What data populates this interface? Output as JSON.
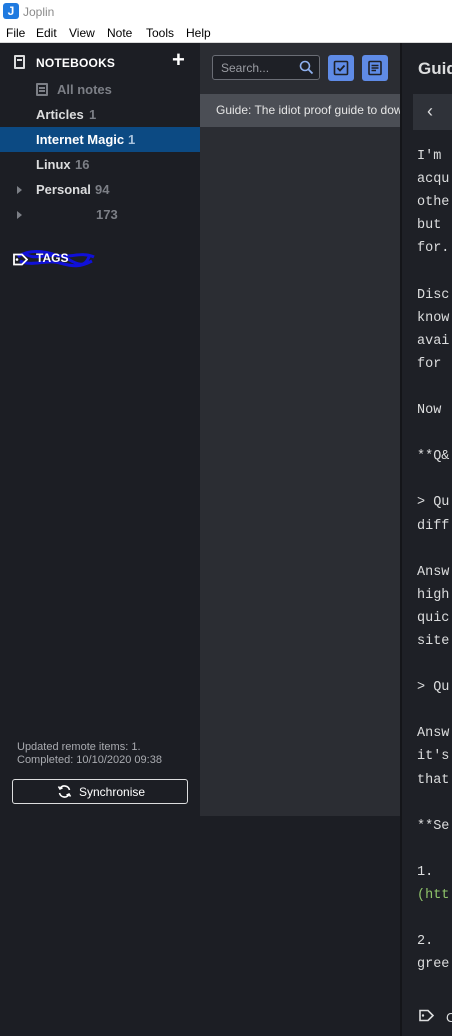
{
  "window": {
    "title": "Joplin",
    "app_icon_letter": "J"
  },
  "menu": [
    "File",
    "Edit",
    "View",
    "Note",
    "Tools",
    "Help"
  ],
  "sidebar": {
    "notebooks_header": "NOTEBOOKS",
    "add_icon": "plus-icon",
    "items": [
      {
        "name": "All notes",
        "count": ""
      },
      {
        "name": "Articles",
        "count": "1"
      },
      {
        "name": "Internet Magic",
        "count": "1",
        "selected": true
      },
      {
        "name": "Linux",
        "count": "16"
      },
      {
        "name": "Personal",
        "count": "94",
        "collapsed": true
      },
      {
        "name": "",
        "count": "173",
        "collapsed": true,
        "redacted": true
      }
    ],
    "tags_header": "TAGS",
    "sync_status_line1": "Updated remote items: 1.",
    "sync_status_line2": "Completed: 10/10/2020 09:38",
    "sync_button": "Synchronise"
  },
  "notelist": {
    "search_placeholder": "Search...",
    "notes": [
      {
        "title": "Guide: The idiot proof guide to dow"
      }
    ]
  },
  "editor": {
    "title": "Guid",
    "lines": [
      "I'm ",
      "acqu",
      "othe",
      "but ",
      "for.",
      "",
      "Disc",
      "know",
      "avai",
      "for ",
      "",
      "Now ",
      "",
      "**Q&",
      "",
      "> Qu",
      "diff",
      "",
      "Answ",
      "high",
      "quic",
      "site",
      "",
      "> Qu",
      "",
      "Answ",
      "it's",
      "that",
      "",
      "**Se",
      "",
      "1. ",
      "(htt",
      "",
      "2. ",
      "gree"
    ],
    "tag_text": "C"
  },
  "colors": {
    "accent": "#5f8be6",
    "selected": "#0c4a83",
    "link": "#8fc46a"
  }
}
